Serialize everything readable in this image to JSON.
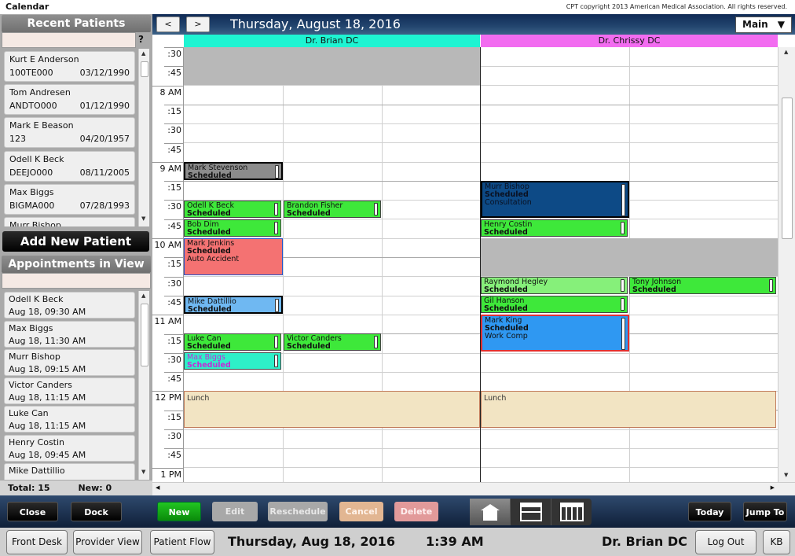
{
  "app": {
    "title": "Calendar",
    "copyright": "CPT copyright 2013 American Medical Association. All rights reserved."
  },
  "recent_patients": {
    "header": "Recent Patients",
    "search_placeholder": "",
    "help": "?",
    "items": [
      {
        "name": "Kurt E Anderson",
        "id": "100TE000",
        "dob": "03/12/1990"
      },
      {
        "name": "Tom Andresen",
        "id": "ANDTO000",
        "dob": "01/12/1990"
      },
      {
        "name": "Mark E Beason",
        "id": "123",
        "dob": "04/20/1957"
      },
      {
        "name": "Odell K Beck",
        "id": "DEEJO000",
        "dob": "08/11/2005"
      },
      {
        "name": "Max Biggs",
        "id": "BIGMA000",
        "dob": "07/28/1993"
      },
      {
        "name": "Murr Bishop",
        "id": "",
        "dob": ""
      }
    ]
  },
  "add_patient_label": "Add New Patient",
  "appointments_in_view": {
    "header": "Appointments in View",
    "items": [
      {
        "name": "Odell K Beck",
        "when": "Aug 18, 09:30 AM"
      },
      {
        "name": "Max Biggs",
        "when": "Aug 18, 11:30 AM"
      },
      {
        "name": "Murr Bishop",
        "when": "Aug 18, 09:15 AM"
      },
      {
        "name": "Victor Canders",
        "when": "Aug 18, 11:15 AM"
      },
      {
        "name": "Luke Can",
        "when": "Aug 18, 11:15 AM"
      },
      {
        "name": "Henry Costin",
        "when": "Aug 18, 09:45 AM"
      },
      {
        "name": "Mike Dattillio",
        "when": ""
      }
    ]
  },
  "totals": {
    "total": "Total: 15",
    "new": "New: 0"
  },
  "calendar": {
    "prev": "<",
    "next": ">",
    "date": "Thursday, August 18, 2016",
    "view": "Main",
    "providers": [
      {
        "name": "Dr. Brian DC",
        "color": "#1ef4d2"
      },
      {
        "name": "Dr. Chrissy DC",
        "color": "#f26cf0"
      }
    ],
    "time_labels": [
      ":30",
      ":45",
      "8 AM",
      ":15",
      ":30",
      ":45",
      "9 AM",
      ":15",
      ":30",
      ":45",
      "10 AM",
      ":15",
      ":30",
      ":45",
      "11 AM",
      ":15",
      ":30",
      ":45",
      "12 PM",
      ":15",
      ":30",
      ":45",
      "1 PM"
    ],
    "appointments": [
      {
        "name": "Mark Stevenson",
        "status": "Scheduled",
        "note": "",
        "color": "#8c8c8c",
        "sel": true
      },
      {
        "name": "Odell K Beck",
        "status": "Scheduled",
        "note": "",
        "color": "#3ee83a"
      },
      {
        "name": "Brandon Fisher",
        "status": "Scheduled",
        "note": "",
        "color": "#3ee83a"
      },
      {
        "name": "Bob Dim",
        "status": "Scheduled",
        "note": "",
        "color": "#3ee83a"
      },
      {
        "name": "Mark Jenkins",
        "status": "Scheduled",
        "note": "Auto Accident",
        "color": "#f47272"
      },
      {
        "name": "Mike Dattillio",
        "status": "Scheduled",
        "note": "",
        "color": "#6fb8f2",
        "sel": true
      },
      {
        "name": "Luke Can",
        "status": "Scheduled",
        "note": "",
        "color": "#3ee83a"
      },
      {
        "name": "Victor Canders",
        "status": "Scheduled",
        "note": "",
        "color": "#3ee83a"
      },
      {
        "name": "Max Biggs",
        "status": "Scheduled",
        "note": "",
        "color": "#2ef0c8"
      },
      {
        "name": "Murr Bishop",
        "status": "Scheduled",
        "note": "Consultation",
        "color": "#0d4a86",
        "sel": true
      },
      {
        "name": "Henry Costin",
        "status": "Scheduled",
        "note": "",
        "color": "#3ee83a"
      },
      {
        "name": "Raymond Hegley",
        "status": "Scheduled",
        "note": "",
        "color": "#86f07a"
      },
      {
        "name": "Tony Johnson",
        "status": "Scheduled",
        "note": "",
        "color": "#3ee83a"
      },
      {
        "name": "Gil Hanson",
        "status": "Scheduled",
        "note": "",
        "color": "#3ee83a"
      },
      {
        "name": "Mark King",
        "status": "Scheduled",
        "note": "Work Comp",
        "color": "#2f98f2"
      }
    ],
    "lunch_label": "Lunch"
  },
  "toolbar": {
    "close": "Close",
    "dock": "Dock",
    "new": "New",
    "edit": "Edit",
    "reschedule": "Reschedule",
    "cancel": "Cancel",
    "delete": "Delete",
    "today": "Today",
    "jump_to": "Jump To"
  },
  "status": {
    "front_desk": "Front Desk",
    "provider_view": "Provider View",
    "patient_flow": "Patient Flow",
    "date": "Thursday, Aug 18, 2016",
    "time": "1:39 AM",
    "provider": "Dr. Brian DC",
    "logout": "Log Out",
    "user": "KB"
  }
}
